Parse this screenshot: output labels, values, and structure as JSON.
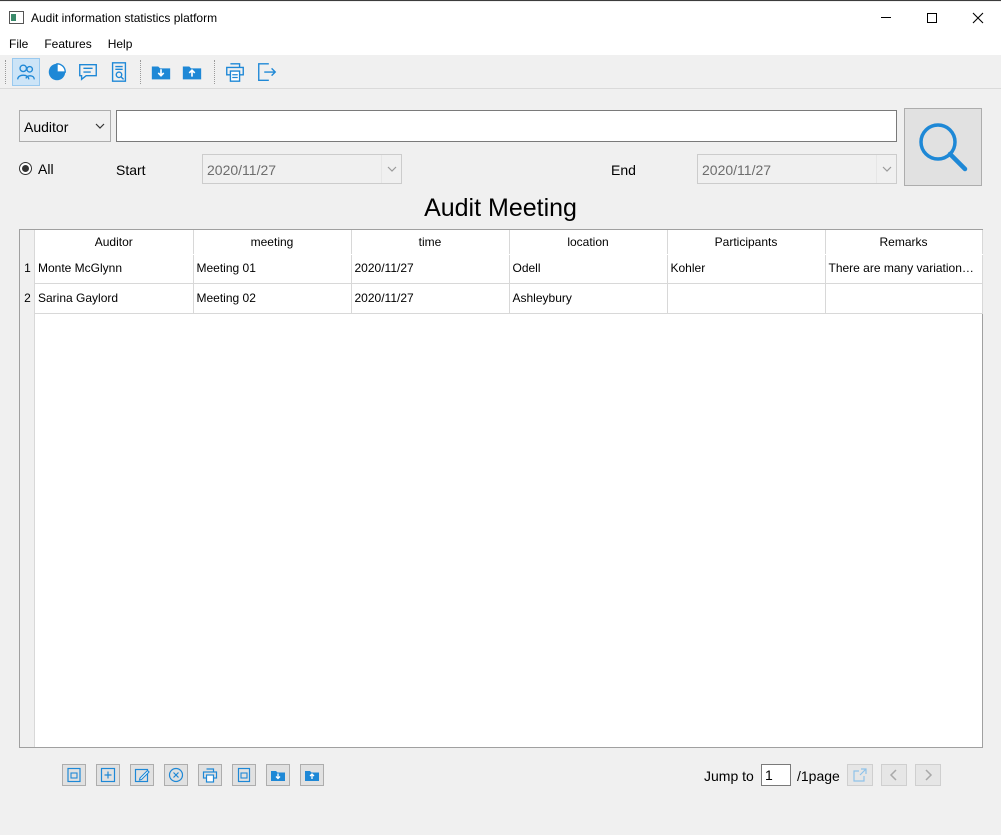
{
  "window": {
    "title": "Audit information statistics platform"
  },
  "menu": {
    "items": [
      "File",
      "Features",
      "Help"
    ]
  },
  "toolbar": {
    "icons": [
      "people-icon",
      "pie-chart-icon",
      "chat-icon",
      "document-search-icon",
      "import-icon",
      "export-icon",
      "print-icon",
      "exit-icon"
    ],
    "accent": "#1e88d6"
  },
  "search": {
    "field_selected": "Auditor",
    "query": ""
  },
  "filter": {
    "all_label": "All",
    "start_label": "Start",
    "start_value": "2020/11/27",
    "end_label": "End",
    "end_value": "2020/11/27"
  },
  "heading": "Audit Meeting",
  "table": {
    "columns": [
      "Auditor",
      "meeting",
      "time",
      "location",
      "Participants",
      "Remarks"
    ],
    "rows": [
      {
        "num": "1",
        "cells": [
          "Monte McGlynn",
          "Meeting 01",
          "2020/11/27",
          "Odell",
          "Kohler",
          "There are many variations ..."
        ]
      },
      {
        "num": "2",
        "cells": [
          "Sarina Gaylord",
          "Meeting 02",
          "2020/11/27",
          "Ashleybury",
          "",
          ""
        ]
      }
    ]
  },
  "pagination": {
    "jump_label": "Jump to",
    "page_value": "1",
    "page_suffix": "/1page"
  },
  "bottom_actions": [
    "save-icon",
    "add-icon",
    "edit-icon",
    "delete-icon",
    "print-icon",
    "document-icon",
    "import-icon",
    "export-icon"
  ]
}
